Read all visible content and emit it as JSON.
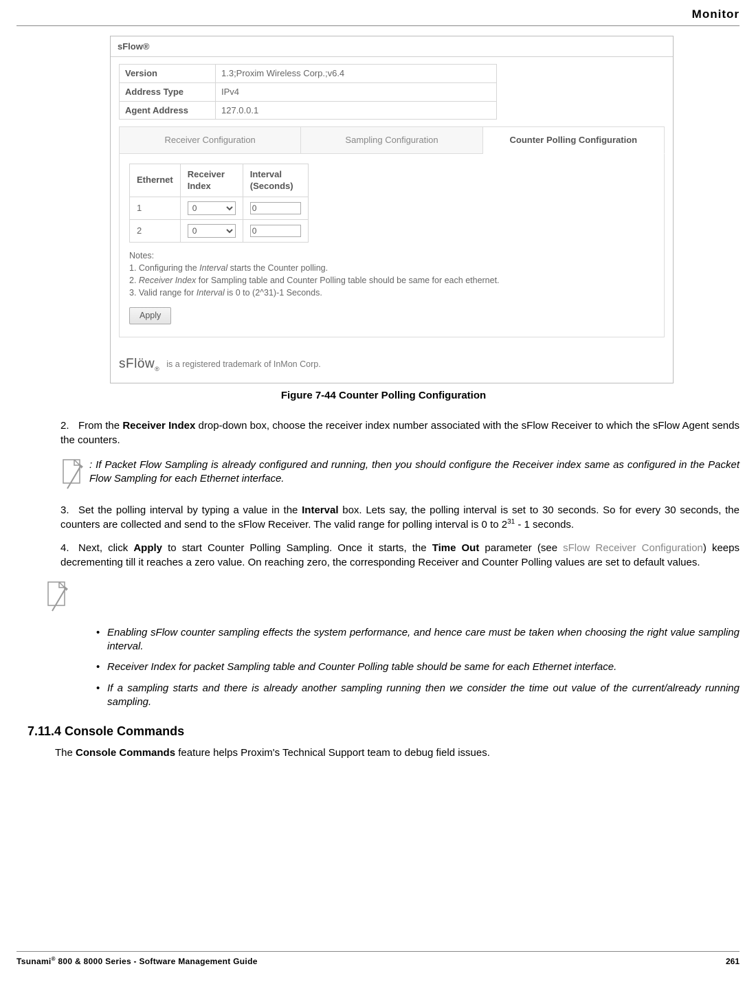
{
  "header": {
    "section": "Monitor"
  },
  "screenshot": {
    "title": "sFlow®",
    "fields": [
      {
        "label": "Version",
        "value": "1.3;Proxim Wireless Corp.;v6.4"
      },
      {
        "label": "Address Type",
        "value": "IPv4"
      },
      {
        "label": "Agent Address",
        "value": "127.0.0.1"
      }
    ],
    "tabs": {
      "t1": "Receiver Configuration",
      "t2": "Sampling Configuration",
      "t3": "Counter Polling Configuration"
    },
    "poll_headers": {
      "c1": "Ethernet",
      "c2": "Receiver\nIndex",
      "c3": "Interval\n(Seconds)"
    },
    "rows": [
      {
        "eth": "1",
        "idx": "0",
        "interval": "0"
      },
      {
        "eth": "2",
        "idx": "0",
        "interval": "0"
      }
    ],
    "notes_hdr": "Notes:",
    "note1_a": "1. Configuring the ",
    "note1_b": "Interval",
    "note1_c": " starts the Counter polling.",
    "note2_a": "2. ",
    "note2_b": "Receiver Index",
    "note2_c": " for Sampling table and Counter Polling table should be same for each ethernet.",
    "note3_a": "3. Valid range for ",
    "note3_b": "Interval",
    "note3_c": " is 0 to (2^31)-1 Seconds.",
    "apply": "Apply",
    "trademark": "is a registered trademark of InMon Corp."
  },
  "figure_caption": "Figure 7-44 Counter Polling Configuration",
  "steps": {
    "s2_num": "2.",
    "s2_a": "From the ",
    "s2_b": "Receiver Index",
    "s2_c": " drop-down box, choose the receiver index number associated with the sFlow Receiver to which the sFlow Agent sends the counters.",
    "s3_num": "3.",
    "s3_a": "Set the polling interval by typing a value in the ",
    "s3_b": "Interval",
    "s3_c": " box. Lets say, the polling interval is set to 30 seconds. So for every 30 seconds, the counters are collected and send to the sFlow Receiver. The valid range for polling interval is 0 to 2",
    "s3_sup": "31",
    "s3_d": " - 1 seconds.",
    "s4_num": "4.",
    "s4_a": "Next, click ",
    "s4_b": "Apply",
    "s4_c": " to start Counter Polling Sampling. Once it starts, the ",
    "s4_d": "Time Out",
    "s4_e": " parameter (see ",
    "s4_f": "sFlow Receiver Configuration",
    "s4_g": ") keeps decrementing till it reaches a zero value. On reaching zero, the corresponding Receiver and Counter Polling values are set to default values."
  },
  "note1": ": If Packet Flow Sampling is already configured and running, then you should configure the Receiver index same as configured in the Packet Flow Sampling for each Ethernet interface.",
  "bullets": {
    "b1": "Enabling sFlow counter sampling effects the system performance, and hence care must be taken when choosing the right value sampling interval.",
    "b2": "Receiver Index for packet Sampling table and Counter Polling table should be same for each Ethernet interface.",
    "b3": "If a sampling starts and there is already another sampling running then we consider the time out value of the current/already running sampling."
  },
  "section": {
    "heading": "7.11.4 Console Commands",
    "para_a": "The ",
    "para_b": "Console Commands",
    "para_c": " feature helps Proxim's Technical Support team to debug field issues."
  },
  "footer": {
    "left_a": "Tsunami",
    "left_b": " 800 & 8000 Series - Software Management Guide",
    "page": "261"
  }
}
